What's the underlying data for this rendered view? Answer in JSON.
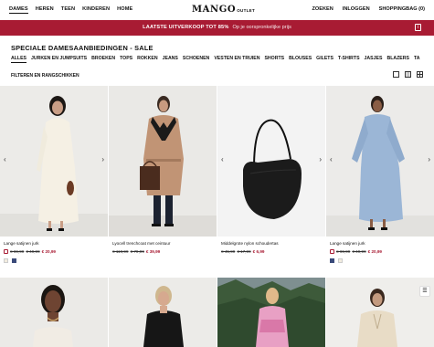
{
  "nav": {
    "left": [
      "DAMES",
      "HEREN",
      "TEEN",
      "KINDEREN",
      "HOME"
    ],
    "logo": "MANGO",
    "logo_suffix": "OUTLET",
    "right": [
      "ZOEKEN",
      "INLOGGEN",
      "SHOPPINGBAG (0)"
    ]
  },
  "banner": {
    "main": "LAATSTE UITVERKOOP TOT 85%",
    "sub": "Op je oorspronkelijke prijs",
    "info_icon": "info-icon"
  },
  "page_title": "SPECIALE DAMESAANBIEDINGEN - SALE",
  "categories": [
    "ALLES",
    "JURKEN EN JUMPSUITS",
    "BROEKEN",
    "TOPS",
    "ROKKEN",
    "JEANS",
    "SCHOENEN",
    "VESTEN EN TRUIEN",
    "SHORTS",
    "BLOUSES",
    "GILETS",
    "T-SHIRTS",
    "JASJES",
    "BLAZERS",
    "TA"
  ],
  "filter_label": "FILTEREN EN RANGSCHIKKEN",
  "products": [
    {
      "name": "Lange satijnen jurk",
      "old1": "€ 69,99",
      "old2": "€ 49,99",
      "price": "€ 20,99",
      "swatches": [
        "#f2ecdf",
        "#3a4a7a"
      ]
    },
    {
      "name": "Lyocell trenchcoat met ceintuur",
      "old1": "€ 119,99",
      "old2": "€ 79,99",
      "price": "€ 39,99",
      "swatches": []
    },
    {
      "name": "Middelgrote nylon schoudertas",
      "old1": "€ 45,99",
      "old2": "€ 17,99",
      "price": "€ 6,99",
      "swatches": []
    },
    {
      "name": "Lange satijnen jurk",
      "old1": "€ 69,99",
      "old2": "€ 49,99",
      "price": "€ 20,99",
      "swatches": [
        "#3a4a7a",
        "#f2ecdf"
      ]
    }
  ],
  "colors": {
    "accent": "#a81b33"
  }
}
